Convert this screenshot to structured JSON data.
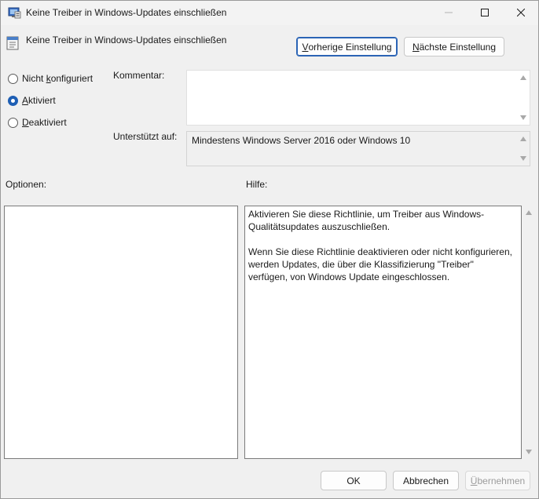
{
  "window": {
    "title": "Keine Treiber in Windows-Updates einschließen"
  },
  "header": {
    "policy_title": "Keine Treiber in Windows-Updates einschließen",
    "prev_button": {
      "label_pre": "",
      "label_u": "V",
      "label_post": "orherige Einstellung"
    },
    "next_button": {
      "label_pre": "",
      "label_u": "N",
      "label_post": "ächste Einstellung"
    }
  },
  "state": {
    "options": [
      {
        "pre": "Nicht ",
        "u": "k",
        "post": "onfiguriert",
        "checked": false
      },
      {
        "pre": "",
        "u": "A",
        "post": "ktiviert",
        "checked": true
      },
      {
        "pre": "",
        "u": "D",
        "post": "eaktiviert",
        "checked": false
      }
    ]
  },
  "comment": {
    "label": "Kommentar:",
    "value": ""
  },
  "supported": {
    "label": "Unterstützt auf:",
    "value": "Mindestens Windows Server 2016 oder Windows 10"
  },
  "options_panel": {
    "label": "Optionen:"
  },
  "help_panel": {
    "label": "Hilfe:",
    "paragraph1": "Aktivieren Sie diese Richtlinie, um Treiber aus Windows-Qualitätsupdates auszuschließen.",
    "paragraph2": "Wenn Sie diese Richtlinie deaktivieren oder nicht konfigurieren, werden Updates, die über die Klassifizierung \"Treiber\" verfügen, von Windows Update eingeschlossen."
  },
  "footer": {
    "ok_label": "OK",
    "cancel_label": "Abbrechen",
    "apply": {
      "label_u": "Ü",
      "label_post": "bernehmen"
    }
  },
  "colors": {
    "accent": "#1e5fb4",
    "window_bg": "#f0f0f0"
  }
}
